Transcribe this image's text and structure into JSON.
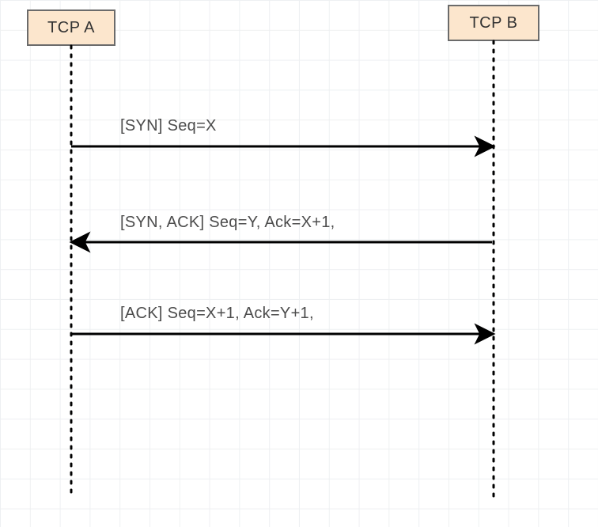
{
  "diagram": {
    "type": "sequence",
    "participants": {
      "a": {
        "label": "TCP A"
      },
      "b": {
        "label": "TCP B"
      }
    },
    "messages": {
      "m1": {
        "label": "[SYN] Seq=X",
        "from": "a",
        "to": "b"
      },
      "m2": {
        "label": "[SYN, ACK] Seq=Y, Ack=X+1,",
        "from": "b",
        "to": "a"
      },
      "m3": {
        "label": "[ACK] Seq=X+1, Ack=Y+1,",
        "from": "a",
        "to": "b"
      }
    }
  }
}
